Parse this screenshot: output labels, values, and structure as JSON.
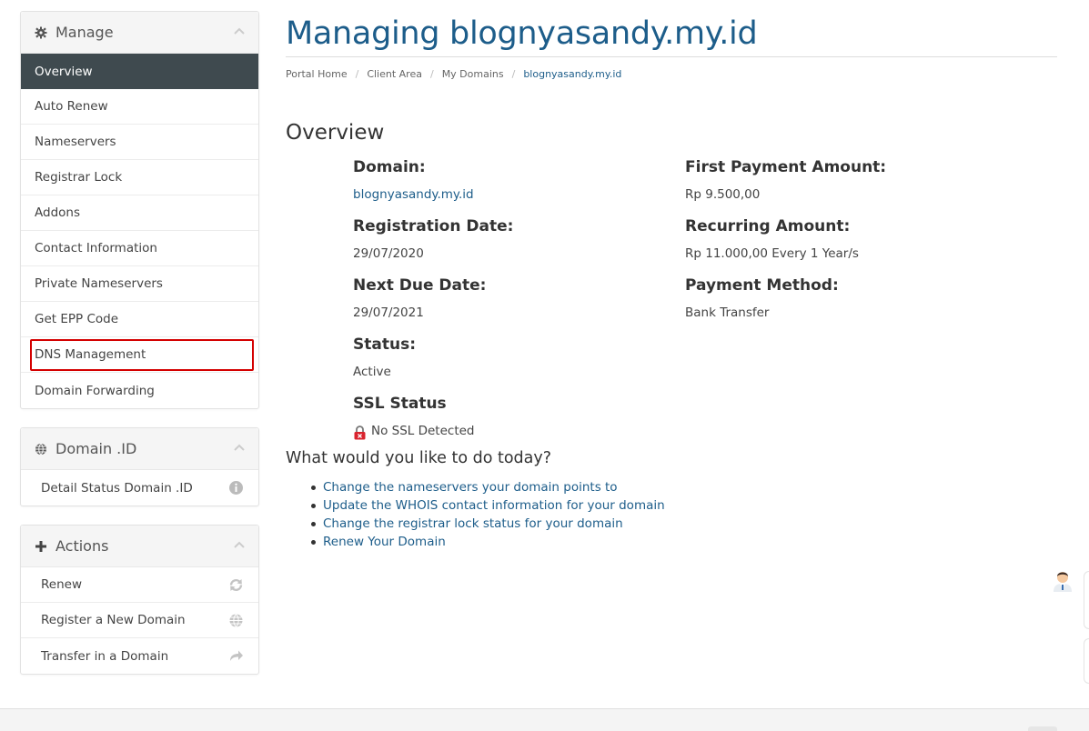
{
  "sidebar": {
    "manage": {
      "title": "Manage",
      "items": [
        {
          "label": "Overview",
          "active": true
        },
        {
          "label": "Auto Renew"
        },
        {
          "label": "Nameservers"
        },
        {
          "label": "Registrar Lock"
        },
        {
          "label": "Addons"
        },
        {
          "label": "Contact Information"
        },
        {
          "label": "Private Nameservers"
        },
        {
          "label": "Get EPP Code"
        },
        {
          "label": "DNS Management",
          "highlighted": true
        },
        {
          "label": "Domain Forwarding"
        }
      ]
    },
    "domain_id": {
      "title": "Domain .ID",
      "items": [
        {
          "label": "Detail Status Domain .ID",
          "icon": "info-icon"
        }
      ]
    },
    "actions": {
      "title": "Actions",
      "items": [
        {
          "label": "Renew",
          "icon": "refresh-icon"
        },
        {
          "label": "Register a New Domain",
          "icon": "globe-icon"
        },
        {
          "label": "Transfer in a Domain",
          "icon": "share-icon"
        }
      ]
    }
  },
  "main": {
    "title": "Managing blognyasandy.my.id",
    "breadcrumb": [
      "Portal Home",
      "Client Area",
      "My Domains",
      "blognyasandy.my.id"
    ],
    "section_title": "Overview",
    "details_left": [
      {
        "label": "Domain:",
        "value": "blognyasandy.my.id"
      },
      {
        "label": "Registration Date:",
        "value": "29/07/2020"
      },
      {
        "label": "Next Due Date:",
        "value": "29/07/2021"
      },
      {
        "label": "Status:",
        "value": "Active"
      },
      {
        "label": "SSL Status",
        "value": "No SSL Detected"
      }
    ],
    "details_right": [
      {
        "label": "First Payment Amount:",
        "value": "Rp 9.500,00"
      },
      {
        "label": "Recurring Amount:",
        "value": "Rp 11.000,00 Every 1 Year/s"
      },
      {
        "label": "Payment Method:",
        "value": "Bank Transfer"
      }
    ],
    "todo_title": "What would you like to do today?",
    "todo_links": [
      "Change the nameservers your domain points to",
      "Update the WHOIS contact information for your domain",
      "Change the registrar lock status for your domain",
      "Renew Your Domain"
    ]
  },
  "colors": {
    "accent": "#1d5d8a",
    "active_menu_bg": "#3f4a4f",
    "highlight": "#d40000"
  }
}
